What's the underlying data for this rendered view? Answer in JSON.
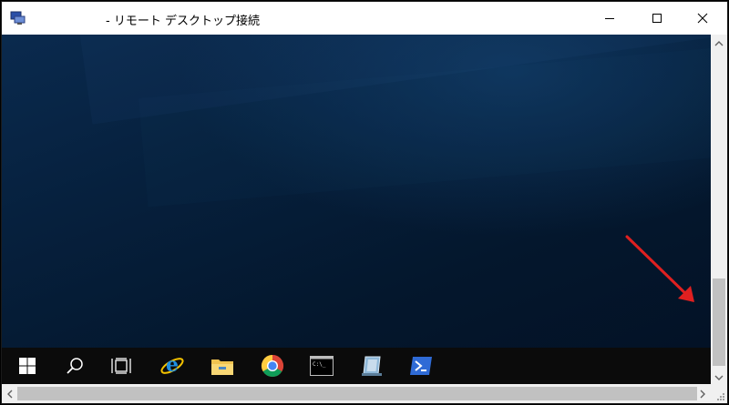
{
  "window": {
    "title": "- リモート デスクトップ接続",
    "icon": "remote-desktop-icon",
    "controls": [
      "minimize-icon",
      "maximize-icon",
      "close-icon"
    ]
  },
  "taskbar": {
    "items": [
      {
        "name": "start-button",
        "icon": "windows-logo-icon"
      },
      {
        "name": "search-button",
        "icon": "search-icon"
      },
      {
        "name": "task-view-button",
        "icon": "task-view-icon"
      },
      {
        "name": "internet-explorer-button",
        "icon": "internet-explorer-icon"
      },
      {
        "name": "file-explorer-button",
        "icon": "folder-icon"
      },
      {
        "name": "chrome-button",
        "icon": "chrome-icon"
      },
      {
        "name": "command-prompt-button",
        "icon": "command-prompt-icon"
      },
      {
        "name": "app-button",
        "icon": "app-icon"
      },
      {
        "name": "powershell-button",
        "icon": "powershell-icon"
      }
    ]
  },
  "annotation": {
    "color": "#e02020",
    "icon": "red-arrow-icon"
  }
}
